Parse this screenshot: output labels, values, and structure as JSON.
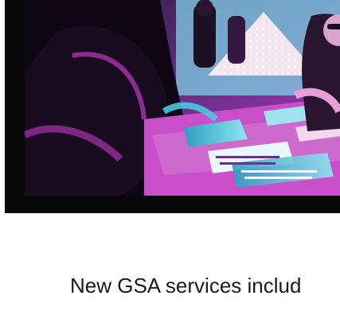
{
  "hero": {
    "image_icon": "photo-image",
    "palette": {
      "magenta": "#c23bc4",
      "cyan": "#49c8e0",
      "dark": "#120a18",
      "frame": "#080808"
    }
  },
  "caption": {
    "line1": "New GSA services includ"
  }
}
